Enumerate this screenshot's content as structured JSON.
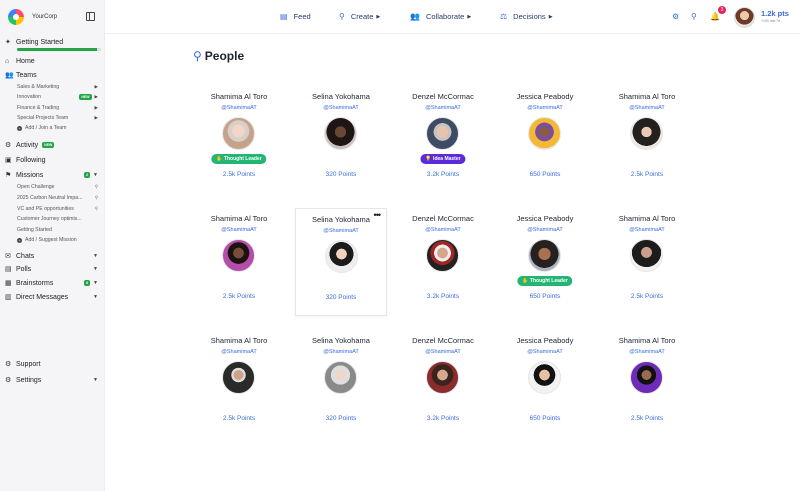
{
  "app": {
    "brand": "YourCorp"
  },
  "sidebar": {
    "getting_started": {
      "label": "Getting Started",
      "progress": 0.95
    },
    "home": "Home",
    "teams": {
      "label": "Teams",
      "items": [
        {
          "label": "Sales & Marketing"
        },
        {
          "label": "Innovation",
          "badge": "NEW"
        },
        {
          "label": "Finance & Trading"
        },
        {
          "label": "Special Projects Team"
        }
      ],
      "add": "Add / Join a Team"
    },
    "activity": {
      "label": "Activity",
      "badge": "NEW"
    },
    "following": "Following",
    "missions": {
      "label": "Missions",
      "badge": "2",
      "items": [
        {
          "label": "Open Challenge"
        },
        {
          "label": "2025 Carbon Neutral Impa..."
        },
        {
          "label": "VC and PE opportunities"
        },
        {
          "label": "Customer Journey optimis..."
        },
        {
          "label": "Getting Started"
        }
      ],
      "add": "Add / Suggest Mission"
    },
    "chats": "Chats",
    "polls": "Polls",
    "brainstorms": {
      "label": "Brainstorms",
      "badge": "6"
    },
    "direct_messages": "Direct Messages",
    "support": "Support",
    "settings": "Settings"
  },
  "topbar": {
    "nav": [
      {
        "label": "Feed",
        "icon": "feed-icon"
      },
      {
        "label": "Create",
        "icon": "create-icon"
      },
      {
        "label": "Collaborate",
        "icon": "collaborate-icon"
      },
      {
        "label": "Decisions",
        "icon": "decisions-icon"
      }
    ],
    "notifications": "3",
    "points": "1.2k pts",
    "points_sub": "+190 last 7d"
  },
  "main": {
    "title": "People",
    "people": [
      {
        "name": "Shamima Al Toro",
        "handle": "@ShamimaAT",
        "points": "2.5k Points",
        "tag": "Thought Leader",
        "tag_type": "leader"
      },
      {
        "name": "Selina Yokohama",
        "handle": "@ShamimaAT",
        "points": "320 Points"
      },
      {
        "name": "Denzel McCormac",
        "handle": "@ShamimaAT",
        "points": "3.2k Points",
        "tag": "Idea Master",
        "tag_type": "idea"
      },
      {
        "name": "Jessica Peabody",
        "handle": "@ShamimaAT",
        "points": "650 Points"
      },
      {
        "name": "Shamima Al Toro",
        "handle": "@ShamimaAT",
        "points": "2.5k Points"
      },
      {
        "name": "Shamima Al Toro",
        "handle": "@ShamimaAT",
        "points": "2.5k Points"
      },
      {
        "name": "Selina Yokohama",
        "handle": "@ShamimaAT",
        "points": "320 Points"
      },
      {
        "name": "Denzel McCormac",
        "handle": "@ShamimaAT",
        "points": "3.2k Points"
      },
      {
        "name": "Jessica Peabody",
        "handle": "@ShamimaAT",
        "points": "650 Points",
        "tag": "Thought Leader",
        "tag_type": "leader"
      },
      {
        "name": "Shamima Al Toro",
        "handle": "@ShamimaAT",
        "points": "2.5k Points"
      },
      {
        "name": "Shamima Al Toro",
        "handle": "@ShamimaAT",
        "points": "2.5k Points"
      },
      {
        "name": "Selina Yokohama",
        "handle": "@ShamimaAT",
        "points": "320 Points"
      },
      {
        "name": "Denzel McCormac",
        "handle": "@ShamimaAT",
        "points": "3.2k Points"
      },
      {
        "name": "Jessica Peabody",
        "handle": "@ShamimaAT",
        "points": "650 Points"
      },
      {
        "name": "Shamima Al Toro",
        "handle": "@ShamimaAT",
        "points": "2.5k Points"
      }
    ]
  }
}
